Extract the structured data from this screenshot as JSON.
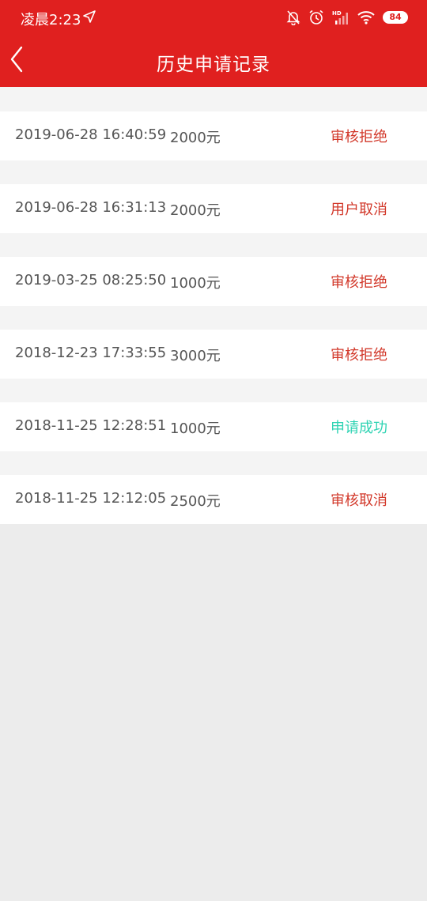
{
  "status_bar": {
    "time": "凌晨2:23",
    "battery": "84"
  },
  "header": {
    "title": "历史申请记录"
  },
  "colors": {
    "header_bg": "#e0201f",
    "status_rejected": "#d2382a",
    "status_success": "#2ed3b3"
  },
  "records": [
    {
      "time": "2019-06-28 16:40:59",
      "amount": "2000元",
      "status": "审核拒绝",
      "status_color": "#d2382a"
    },
    {
      "time": "2019-06-28 16:31:13",
      "amount": "2000元",
      "status": "用户取消",
      "status_color": "#d2382a"
    },
    {
      "time": "2019-03-25 08:25:50",
      "amount": "1000元",
      "status": "审核拒绝",
      "status_color": "#d2382a"
    },
    {
      "time": "2018-12-23 17:33:55",
      "amount": "3000元",
      "status": "审核拒绝",
      "status_color": "#d2382a"
    },
    {
      "time": "2018-11-25 12:28:51",
      "amount": "1000元",
      "status": "申请成功",
      "status_color": "#2ed3b3"
    },
    {
      "time": "2018-11-25 12:12:05",
      "amount": "2500元",
      "status": "审核取消",
      "status_color": "#d2382a"
    }
  ]
}
